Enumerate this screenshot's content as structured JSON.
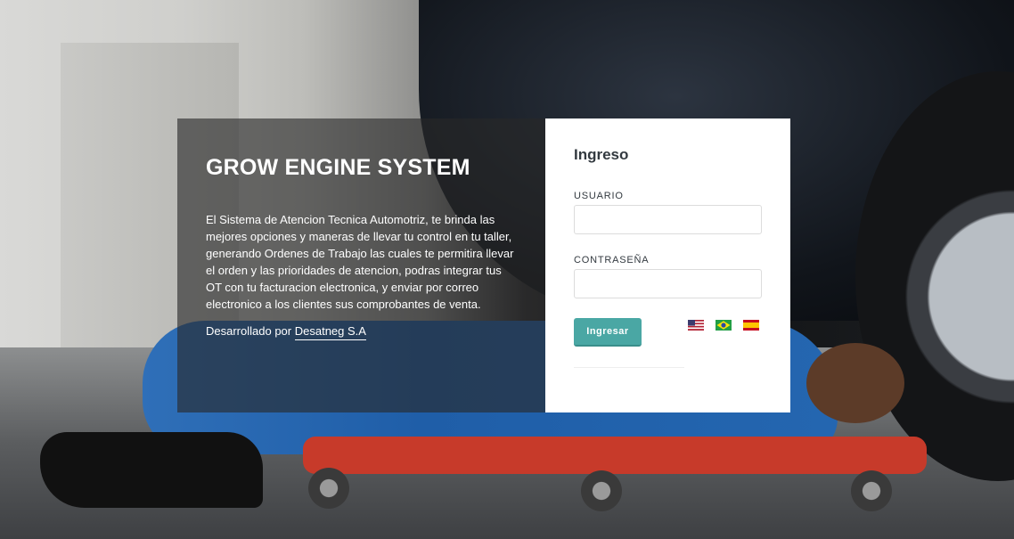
{
  "info": {
    "title": "GROW ENGINE SYSTEM",
    "description": "El Sistema de Atencion Tecnica Automotriz, te brinda las mejores opciones y maneras de llevar tu control en tu taller, generando Ordenes de Trabajo las cuales te permitira llevar el orden y las prioridades de atencion, podras integrar tus OT con tu facturacion electronica, y enviar por correo electronico a los clientes sus comprobantes de venta.",
    "credit_prefix": "Desarrollado por",
    "credit_link": "Desatneg S.A"
  },
  "login": {
    "title": "Ingreso",
    "user_label": "USUARIO",
    "user_value": "",
    "password_label": "CONTRASEÑA",
    "password_value": "",
    "submit_label": "Ingresar",
    "flags": [
      {
        "icon": "us-flag-icon",
        "lang": "en"
      },
      {
        "icon": "brazil-flag-icon",
        "lang": "pt"
      },
      {
        "icon": "spain-flag-icon",
        "lang": "es"
      }
    ]
  },
  "colors": {
    "accent": "#4aa7a4",
    "panel_bg": "rgba(40,40,40,0.62)",
    "card_bg": "#ffffff"
  }
}
